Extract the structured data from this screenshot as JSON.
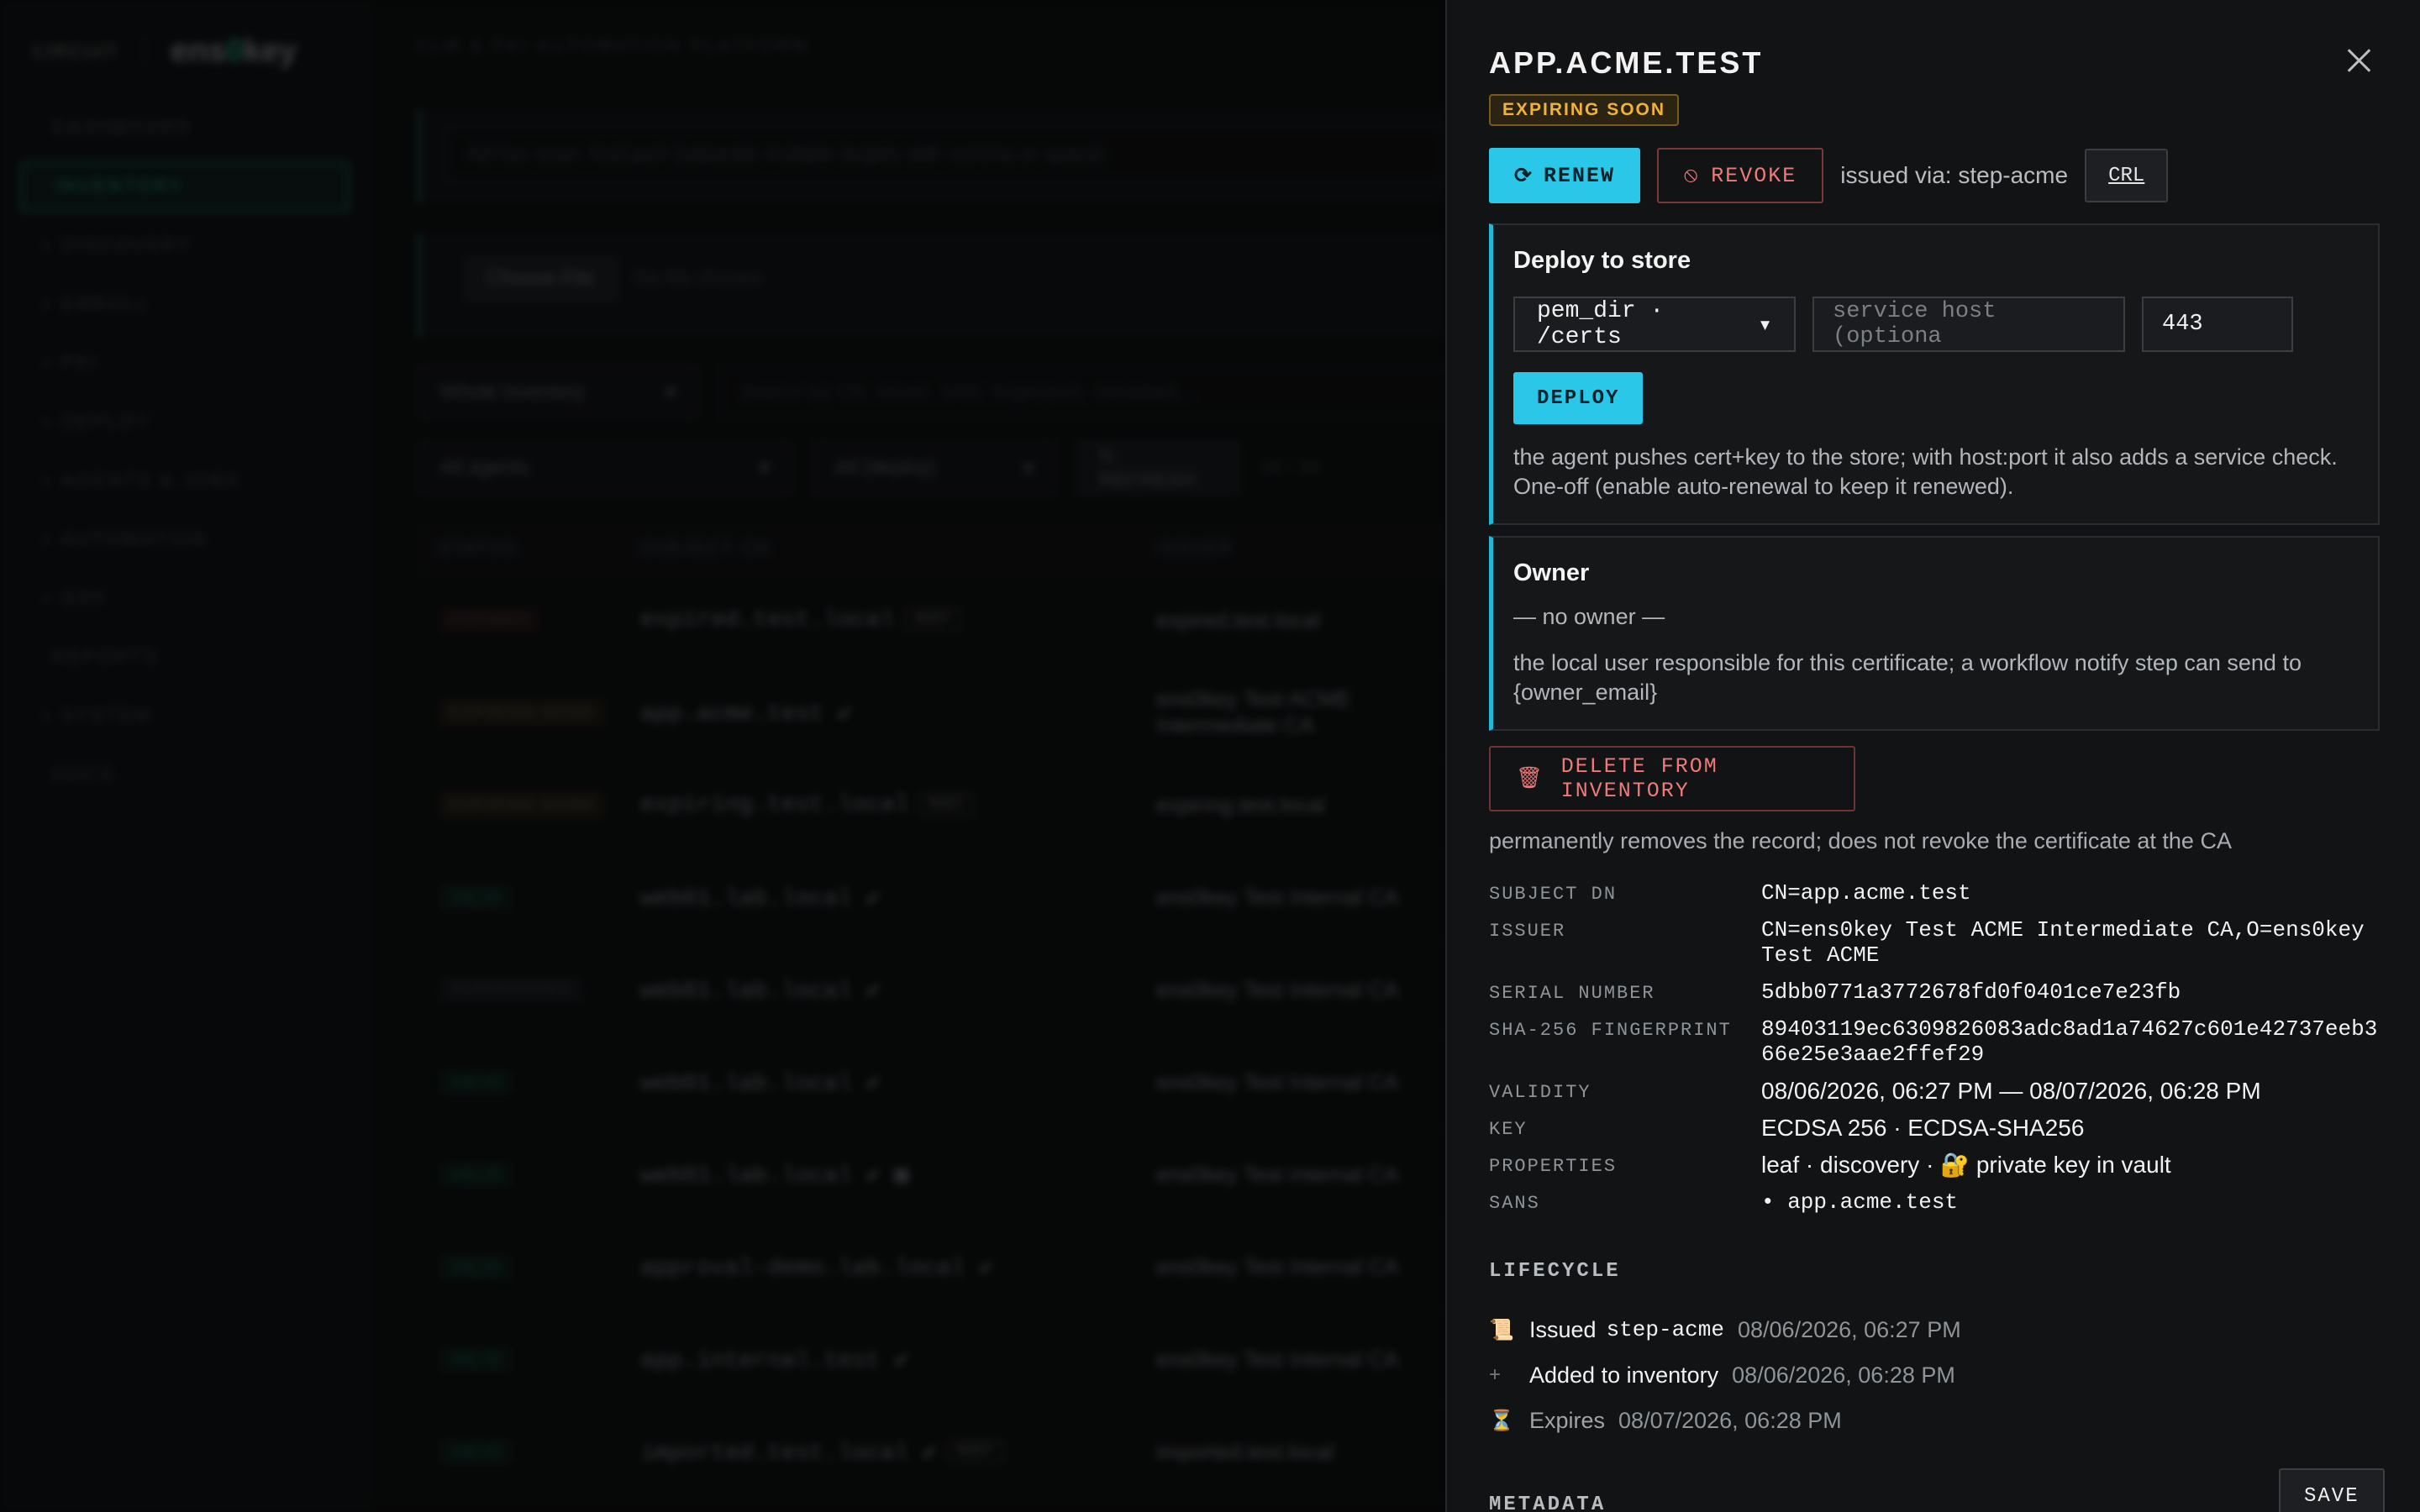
{
  "app": {
    "brand_small": "CIRCUIT",
    "brand_name_pre": "ens",
    "brand_name_zero": "0",
    "brand_name_post": "key",
    "topbar_title": "CLM & PKI AUTOMATION PLATFORM"
  },
  "sidebar": {
    "items": [
      {
        "label": "DASHBOARD",
        "caret": ""
      },
      {
        "label": "INVENTORY",
        "caret": ""
      },
      {
        "label": "DISCOVERY",
        "caret": "▸"
      },
      {
        "label": "ENROLL",
        "caret": "▸"
      },
      {
        "label": "PKI",
        "caret": "▸"
      },
      {
        "label": "DEPLOY",
        "caret": "▸"
      },
      {
        "label": "AGENTS & JOBS",
        "caret": "▸"
      },
      {
        "label": "AUTOMATION",
        "caret": "▸"
      },
      {
        "label": "SSH",
        "caret": "▸"
      },
      {
        "label": "REPORTS",
        "caret": ""
      },
      {
        "label": "SYSTEM",
        "caret": "▸"
      },
      {
        "label": "DOCS",
        "caret": ""
      }
    ]
  },
  "main": {
    "scan_placeholder": "Ad-hoc scan: host:port (separate multiple targets with comma or space)",
    "file_button": "Choose File",
    "file_status": "No file chosen",
    "scope_select": "Whole inventory",
    "search_placeholder": "Search by CN, issuer, SAN, fingerprint, metadata…",
    "agents_select": "All agents",
    "deploy_select": "All (deploy)",
    "refresh_label": "↻ REFRESH",
    "count": "16 / 16",
    "table": {
      "headers": [
        "STATUS",
        "SUBJECT CN",
        "ISSUER"
      ],
      "rows": [
        {
          "status": "EXPIRED",
          "cls": "expired",
          "cn": "expired.test.local",
          "tag": "ROOT",
          "issuer": "expired.test.local"
        },
        {
          "status": "EXPIRING SOON",
          "cls": "exp",
          "cn": "app.acme.test ✔",
          "tag": "",
          "issuer": "ens0key Test ACME Intermediate CA"
        },
        {
          "status": "EXPIRING SOON",
          "cls": "exp",
          "cn": "expiring.test.local",
          "tag": "ROOT",
          "issuer": "expiring.test.local"
        },
        {
          "status": "VALID",
          "cls": "valid",
          "cn": "web01.lab.local ✔",
          "tag": "",
          "issuer": "ens0key Test Internal CA"
        },
        {
          "status": "SUPERSEDED",
          "cls": "super",
          "cn": "web01.lab.local ✔",
          "tag": "",
          "issuer": "ens0key Test Internal CA"
        },
        {
          "status": "VALID",
          "cls": "valid",
          "cn": "web01.lab.local ✔",
          "tag": "",
          "issuer": "ens0key Test Internal CA"
        },
        {
          "status": "VALID",
          "cls": "valid",
          "cn": "web01.lab.local ✔ ▦",
          "tag": "",
          "issuer": "ens0key Test Internal CA"
        },
        {
          "status": "VALID",
          "cls": "valid",
          "cn": "approval-demo.lab.local ✔",
          "tag": "",
          "issuer": "ens0key Test Internal CA"
        },
        {
          "status": "VALID",
          "cls": "valid",
          "cn": "app.internal.test ✔",
          "tag": "",
          "issuer": "ens0key Test Internal CA"
        },
        {
          "status": "VALID",
          "cls": "valid",
          "cn": "imported.test.local ✔",
          "tag": "ROOT",
          "issuer": "imported.test.local"
        }
      ]
    }
  },
  "drawer": {
    "title": "APP.ACME.TEST",
    "status": "EXPIRING SOON",
    "status_color": "#f0b23a",
    "renew_icon": "⟳",
    "renew_label": "RENEW",
    "revoke_icon": "⦸",
    "revoke_label": "REVOKE",
    "issued_via": "issued via: step-acme",
    "crl_label": "CRL",
    "deploy": {
      "title": "Deploy to store",
      "store_select": "pem_dir · /certs",
      "host_placeholder": "service host (optiona",
      "port_value": "443",
      "button": "DEPLOY",
      "help": "the agent pushes cert+key to the store; with host:port it also adds a service check. One-off (enable auto-renewal to keep it renewed)."
    },
    "owner": {
      "title": "Owner",
      "value": "— no owner —",
      "help": "the local user responsible for this certificate; a workflow notify step can send to {owner_email}"
    },
    "delete_icon": "🗑",
    "delete_label": "DELETE FROM INVENTORY",
    "delete_help": "permanently removes the record; does not revoke the certificate at the CA",
    "fields": {
      "subject_dn_label": "SUBJECT DN",
      "subject_dn": "CN=app.acme.test",
      "issuer_label": "ISSUER",
      "issuer": "CN=ens0key Test ACME Intermediate CA,O=ens0key Test ACME",
      "serial_label": "SERIAL NUMBER",
      "serial": "5dbb0771a3772678fd0f0401ce7e23fb",
      "fingerprint_label": "SHA-256 FINGERPRINT",
      "fingerprint": "89403119ec6309826083adc8ad1a74627c601e42737eeb366e25e3aae2ffef29",
      "validity_label": "VALIDITY",
      "validity": "08/06/2026, 06:27 PM — 08/07/2026, 06:28 PM",
      "key_label": "KEY",
      "key": "ECDSA 256 · ECDSA-SHA256",
      "properties_label": "PROPERTIES",
      "properties": "leaf · discovery · 🔐 private key in vault",
      "sans_label": "SANS",
      "sans": "• app.acme.test"
    },
    "lifecycle_title": "LIFECYCLE",
    "lifecycle": [
      {
        "icon": "📜",
        "text": "Issued",
        "code": "step-acme",
        "date": "08/06/2026, 06:27 PM"
      },
      {
        "icon": "+",
        "text": "Added to inventory",
        "code": "",
        "date": "08/06/2026, 06:28 PM"
      },
      {
        "icon": "⏳",
        "text": "Expires",
        "code": "",
        "date": "08/07/2026, 06:28 PM"
      }
    ],
    "save_label": "SAVE",
    "metadata_title": "METADATA"
  }
}
